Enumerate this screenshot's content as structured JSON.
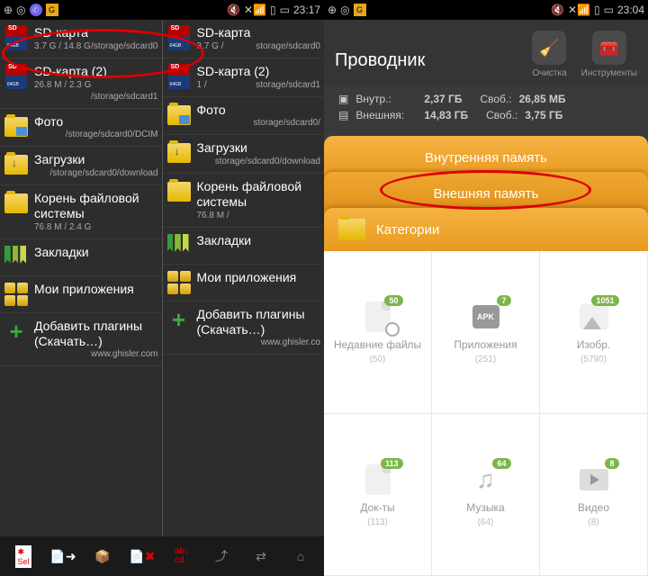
{
  "left": {
    "status": {
      "time": "23:17"
    },
    "paneA": [
      {
        "t": "SD-карта",
        "s1": "3.7 G / 14.8 G",
        "s2": "/storage/sdcard0",
        "icon": "sd"
      },
      {
        "t": "SD-карта (2)",
        "s1": "26.8 M / 2.3 G",
        "s2": "/storage/sdcard1",
        "icon": "sd"
      },
      {
        "t": "Фото",
        "s1": "",
        "s2": "/storage/sdcard0/DCIM",
        "icon": "folder-photo"
      },
      {
        "t": "Загрузки",
        "s1": "",
        "s2": "/storage/sdcard0/download",
        "icon": "folder-down"
      },
      {
        "t": "Корень файловой системы",
        "s1": "76.8 M / 2.4 G",
        "s2": "",
        "icon": "folder"
      },
      {
        "t": "Закладки",
        "s1": "",
        "s2": "",
        "icon": "bookmark"
      },
      {
        "t": "Мои приложения",
        "s1": "",
        "s2": "",
        "icon": "apps"
      },
      {
        "t": "Добавить плагины (Скачать…)",
        "s1": "",
        "s2": "www.ghisler.com",
        "icon": "plus"
      }
    ],
    "paneB": [
      {
        "t": "SD-карта",
        "s1": "3.7 G /",
        "s2": "storage/sdcard0",
        "icon": "sd"
      },
      {
        "t": "SD-карта (2)",
        "s1": "1 /",
        "s2": "storage/sdcard1",
        "icon": "sd"
      },
      {
        "t": "Фото",
        "s1": "",
        "s2": "storage/sdcard0/",
        "icon": "folder-photo"
      },
      {
        "t": "Загрузки",
        "s1": "",
        "s2": "storage/sdcard0/download",
        "icon": "folder-down"
      },
      {
        "t": "Корень файловой системы",
        "s1": "76.8 M /",
        "s2": "",
        "icon": "folder"
      },
      {
        "t": "Закладки",
        "s1": "",
        "s2": "",
        "icon": "bookmark"
      },
      {
        "t": "Мои приложения",
        "s1": "",
        "s2": "",
        "icon": "apps"
      },
      {
        "t": "Добавить плагины (Скачать…)",
        "s1": "",
        "s2": "www.ghisler.co",
        "icon": "plus"
      }
    ]
  },
  "right": {
    "status": {
      "time": "23:04"
    },
    "title": "Проводник",
    "actions": {
      "clean": "Очистка",
      "tools": "Инструменты"
    },
    "storage": {
      "internal_label": "Внутр.:",
      "internal_total": "2,37 ГБ",
      "internal_free_label": "Своб.:",
      "internal_free": "26,85 МБ",
      "external_label": "Внешняя:",
      "external_total": "14,83 ГБ",
      "external_free_label": "Своб.:",
      "external_free": "3,75 ГБ"
    },
    "tabs": {
      "internal": "Внутренняя память",
      "external": "Внешняя память",
      "categories": "Категории"
    },
    "grid": [
      {
        "label": "Недавние файлы",
        "count": "(50)",
        "badge": "50"
      },
      {
        "label": "Приложения",
        "count": "(251)",
        "badge": "7"
      },
      {
        "label": "Изобр.",
        "count": "(5790)",
        "badge": "1051"
      },
      {
        "label": "Док-ты",
        "count": "(113)",
        "badge": "113"
      },
      {
        "label": "Музыка",
        "count": "(64)",
        "badge": "64"
      },
      {
        "label": "Видео",
        "count": "(8)",
        "badge": "8"
      }
    ]
  }
}
